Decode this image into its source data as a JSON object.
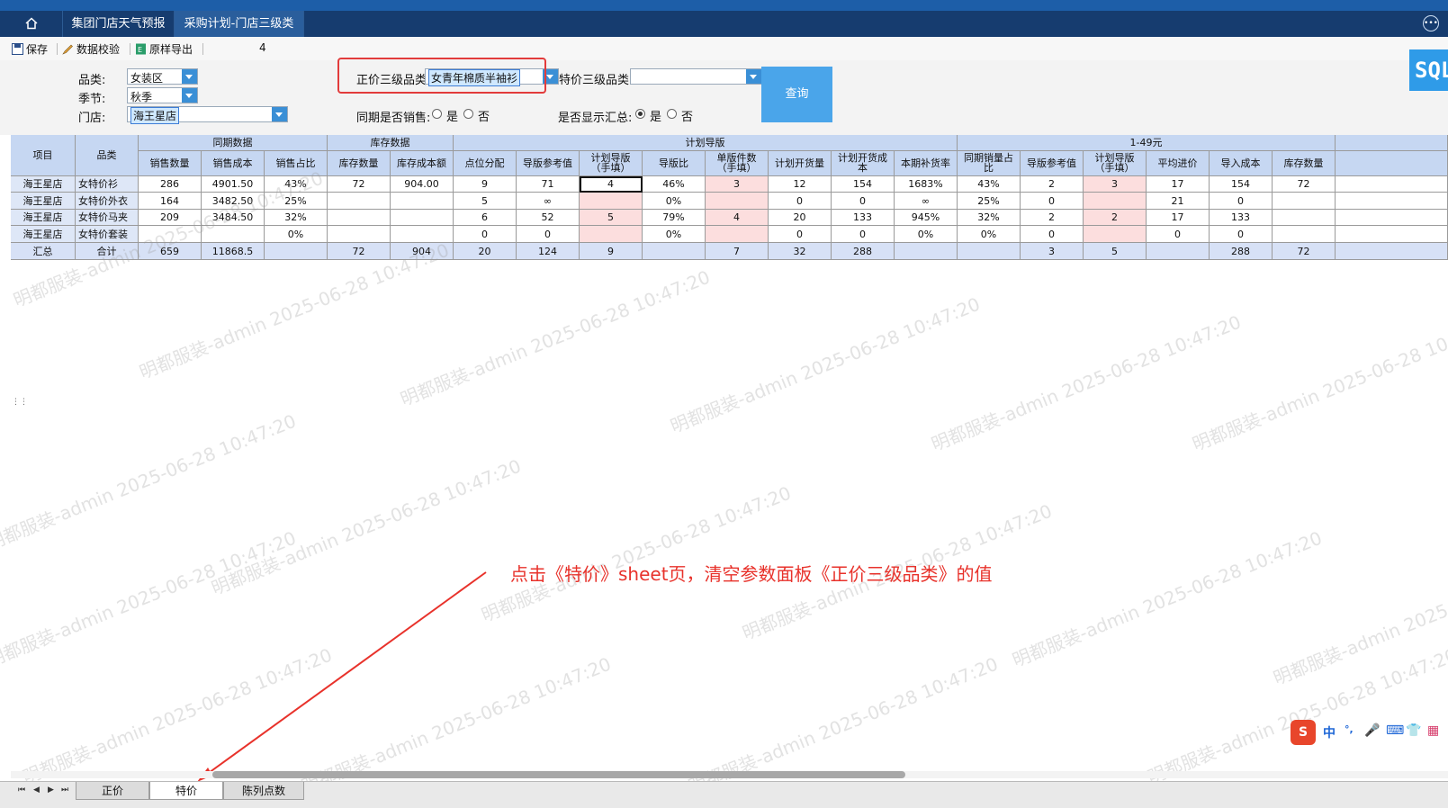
{
  "window": {
    "tabs": [
      {
        "label": "集团门店天气预报"
      },
      {
        "label": "采购计划-门店三级类"
      }
    ]
  },
  "toolbar": {
    "save": "保存",
    "validate": "数据校验",
    "export": "原样导出",
    "count": "4"
  },
  "params": {
    "category_label": "品类:",
    "category_value": "女装区",
    "season_label": "季节:",
    "season_value": "秋季",
    "store_label": "门店:",
    "store_value": "海王星店",
    "regular_label": "正价三级品类:",
    "regular_value": "女青年棉质半袖衫",
    "special_label": "特价三级品类:",
    "special_value": "",
    "same_period_label": "同期是否销售:",
    "same_period_options": [
      "是",
      "否"
    ],
    "show_summary_label": "是否显示汇总:",
    "show_summary_options": [
      "是",
      "否"
    ],
    "show_summary_selected": "是",
    "query_button": "查询",
    "sql_button": "SQL"
  },
  "table": {
    "group_headers": [
      "同期数据",
      "库存数据",
      "计划导版",
      "1-49元"
    ],
    "columns": [
      "项目",
      "品类",
      "销售数量",
      "销售成本",
      "销售占比",
      "库存数量",
      "库存成本额",
      "点位分配",
      "导版参考值",
      "计划导版\n（手填）",
      "导版比",
      "单版件数\n（手填）",
      "计划开货量",
      "计划开货成\n本",
      "本期补货率",
      "同期销量占\n比",
      "导版参考值",
      "计划导版\n（手填）",
      "平均进价",
      "导入成本",
      "库存数量"
    ],
    "rows": [
      [
        "海王星店",
        "女特价衫",
        "286",
        "4901.50",
        "43%",
        "72",
        "904.00",
        "9",
        "71",
        "4",
        "46%",
        "3",
        "12",
        "154",
        "1683%",
        "43%",
        "2",
        "3",
        "17",
        "154",
        "72"
      ],
      [
        "海王星店",
        "女特价外衣",
        "164",
        "3482.50",
        "25%",
        "",
        "",
        "5",
        "∞",
        "",
        "0%",
        "",
        "0",
        "0",
        "∞",
        "25%",
        "0",
        "",
        "21",
        "0",
        ""
      ],
      [
        "海王星店",
        "女特价马夹",
        "209",
        "3484.50",
        "32%",
        "",
        "",
        "6",
        "52",
        "5",
        "79%",
        "4",
        "20",
        "133",
        "945%",
        "32%",
        "2",
        "2",
        "17",
        "133",
        ""
      ],
      [
        "海王星店",
        "女特价套装",
        "",
        "",
        "0%",
        "",
        "",
        "0",
        "0",
        "",
        "0%",
        "",
        "0",
        "0",
        "0%",
        "0%",
        "0",
        "",
        "0",
        "0",
        ""
      ]
    ],
    "total": [
      "汇总",
      "合计",
      "659",
      "11868.5",
      "",
      "72",
      "904",
      "20",
      "124",
      "9",
      "",
      "7",
      "32",
      "288",
      "",
      "",
      "3",
      "5",
      "",
      "288",
      "72"
    ]
  },
  "watermark": "明都服装-admin 2025-06-28 10:47:20",
  "annotation": "点击《特价》sheet页，清空参数面板《正价三级品类》的值",
  "sheets": [
    "正价",
    "特价",
    "陈列点数"
  ],
  "active_sheet": "特价",
  "ime": [
    "中",
    "°,",
    "🎤",
    "⌨",
    "👕",
    "▦"
  ],
  "colors": {
    "header": "#c6d7f2",
    "input_cell": "#fcdede",
    "annotation": "#e8322b",
    "tab_bar": "#163c6f"
  }
}
